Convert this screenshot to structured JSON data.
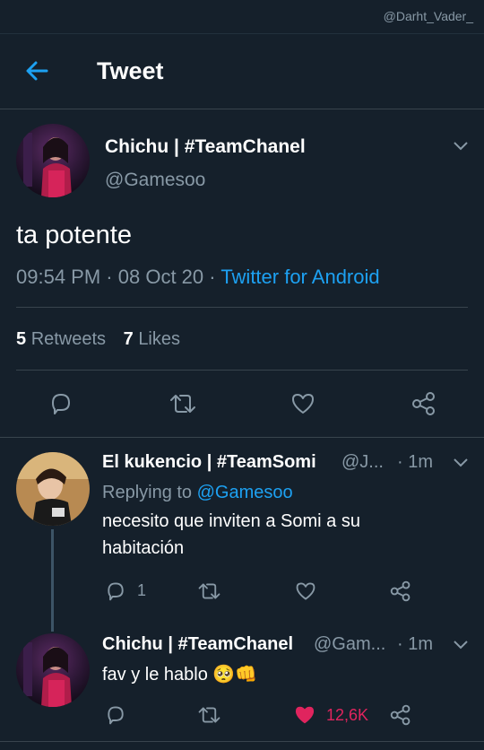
{
  "watermark": "@Darht_Vader_",
  "header": {
    "title": "Tweet"
  },
  "main_tweet": {
    "display_name": "Chichu | #TeamChanel",
    "handle": "@Gamesoo",
    "text": "ta potente",
    "time": "09:54 PM",
    "dot1": "·",
    "date": "08 Oct 20",
    "dot2": "·",
    "source": "Twitter for Android",
    "retweets_count": "5",
    "retweets_label": "Retweets",
    "likes_count": "7",
    "likes_label": "Likes"
  },
  "replies": [
    {
      "display_name": "El kukencio | #TeamSomi",
      "handle": "@J...",
      "time": "· 1m",
      "replying_label": "Replying to",
      "replying_to": "@Gamesoo",
      "text_line1": "necesito que inviten a Somi a su",
      "text_line2": "habitación",
      "reply_count": "1"
    },
    {
      "display_name": "Chichu | #TeamChanel",
      "handle": "@Gam...",
      "time": "· 1m",
      "text": "fav y le hablo",
      "emoji": "🥺👊",
      "like_count": "12,6K"
    }
  ],
  "colors": {
    "background": "#15202b",
    "accent": "#1da1f2",
    "secondary_text": "#8899a6",
    "divider": "#38444d",
    "like": "#e0245e"
  }
}
